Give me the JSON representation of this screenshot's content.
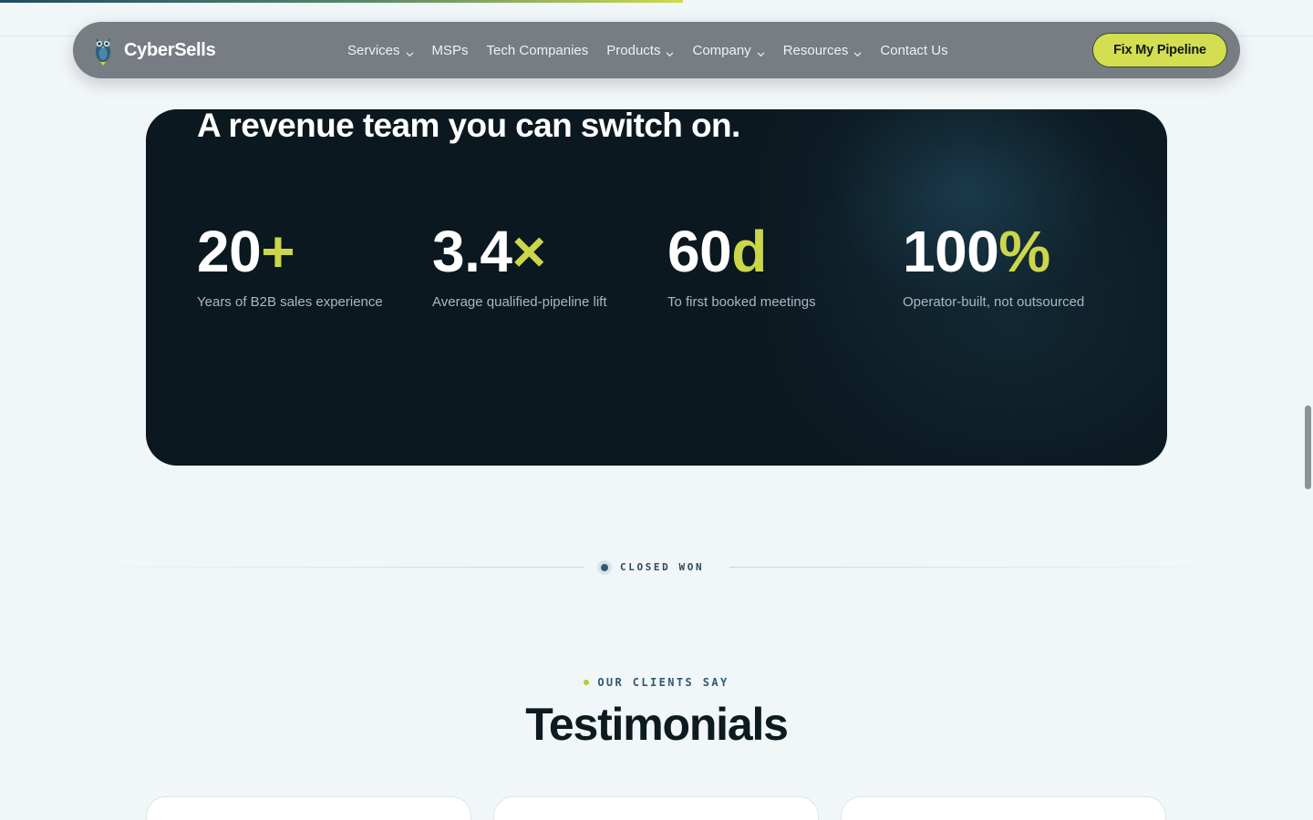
{
  "page": {
    "scroll_progress_percent": 52
  },
  "nav": {
    "brand": "CyberSells",
    "logo_icon": "owl-logo-icon",
    "items": [
      {
        "label": "Services",
        "has_dropdown": true
      },
      {
        "label": "MSPs",
        "has_dropdown": false
      },
      {
        "label": "Tech Companies",
        "has_dropdown": false
      },
      {
        "label": "Products",
        "has_dropdown": true
      },
      {
        "label": "Company",
        "has_dropdown": true
      },
      {
        "label": "Resources",
        "has_dropdown": true
      },
      {
        "label": "Contact Us",
        "has_dropdown": false
      }
    ],
    "cta_label": "Fix My Pipeline"
  },
  "stats_panel": {
    "title": "A revenue team you can switch on.",
    "stats": [
      {
        "number": "20",
        "accent": "+",
        "label": "Years of B2B sales experience"
      },
      {
        "number": "3.4",
        "accent": "×",
        "label": "Average qualified-pipeline lift"
      },
      {
        "number": "60",
        "accent": "d",
        "label": "To first booked meetings"
      },
      {
        "number": "100",
        "accent": "%",
        "label": "Operator-built, not outsourced"
      }
    ]
  },
  "divider": {
    "label": "CLOSED WON"
  },
  "testimonials": {
    "eyebrow": "OUR CLIENTS SAY",
    "title": "Testimonials",
    "card_count": 3
  },
  "colors": {
    "accent": "#cbd64a",
    "panel_bg": "#0b181f",
    "page_bg": "#f1f6f8",
    "nav_bg": "#777d82"
  }
}
